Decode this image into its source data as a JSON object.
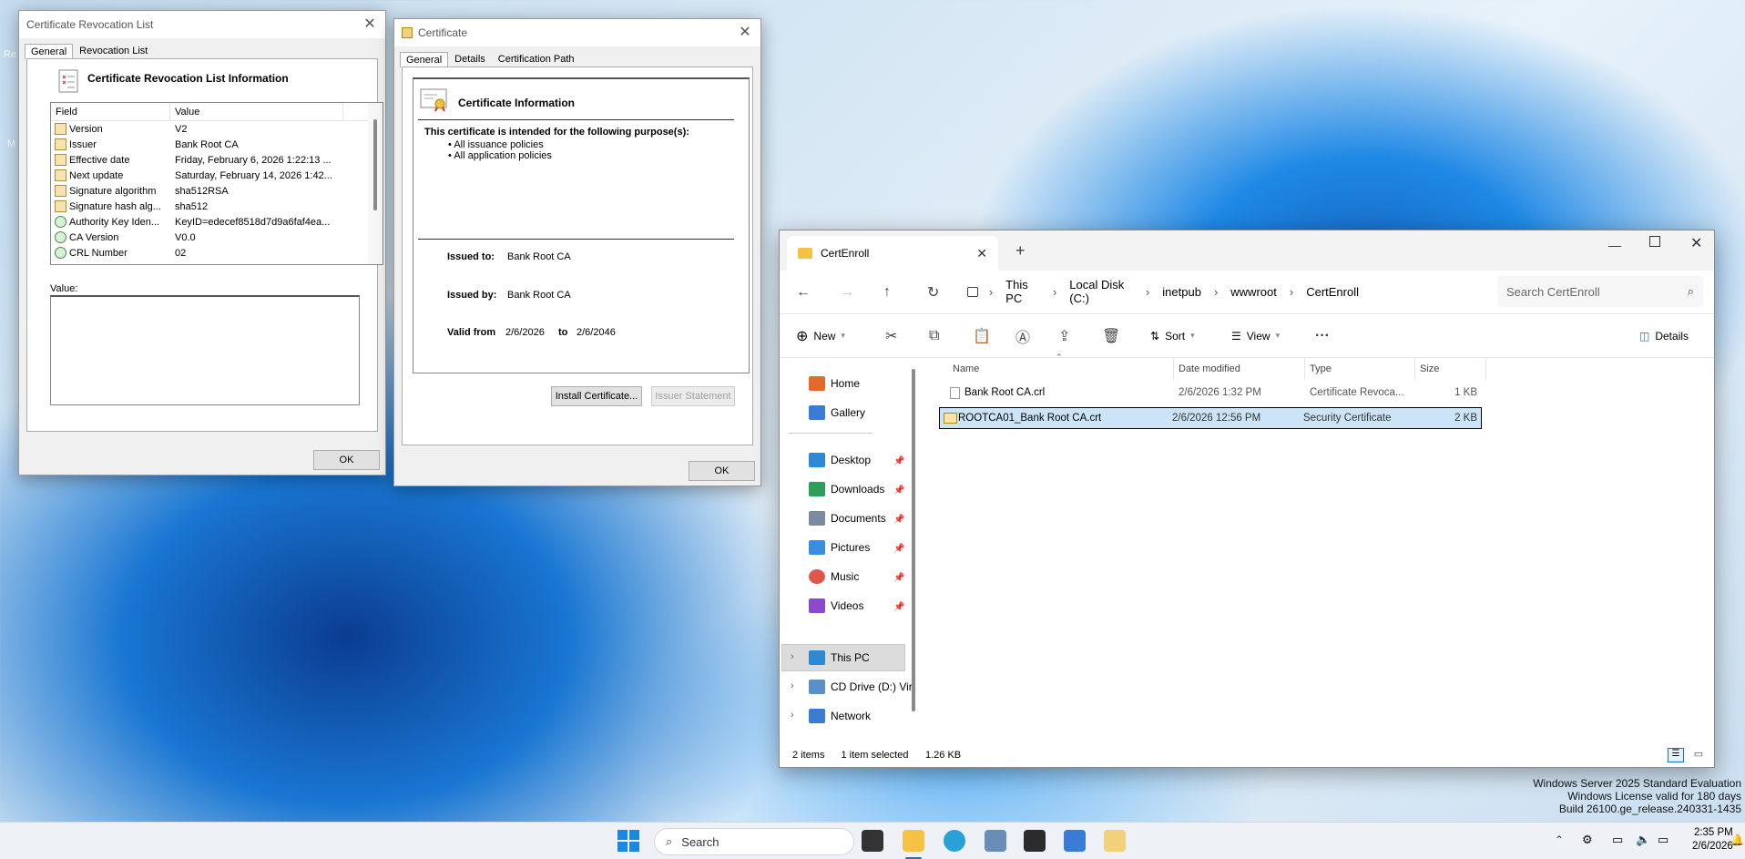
{
  "crl": {
    "title": "Certificate Revocation List",
    "tabs": [
      "General",
      "Revocation List"
    ],
    "heading": "Certificate Revocation List Information",
    "columns": [
      "Field",
      "Value"
    ],
    "rows": [
      [
        "Version",
        "V2"
      ],
      [
        "Issuer",
        "Bank Root CA"
      ],
      [
        "Effective date",
        "Friday, February 6, 2026 1:22:13 ..."
      ],
      [
        "Next update",
        "Saturday, February 14, 2026 1:42..."
      ],
      [
        "Signature algorithm",
        "sha512RSA"
      ],
      [
        "Signature hash alg...",
        "sha512"
      ],
      [
        "Authority Key Iden...",
        "KeyID=edecef8518d7d9a6faf4ea..."
      ],
      [
        "CA Version",
        "V0.0"
      ],
      [
        "CRL Number",
        "02"
      ]
    ],
    "value_label": "Value:",
    "ok": "OK"
  },
  "cert": {
    "title": "Certificate",
    "tabs": [
      "General",
      "Details",
      "Certification Path"
    ],
    "heading": "Certificate Information",
    "purpose": "This certificate is intended for the following purpose(s):",
    "purposes": [
      "All issuance policies",
      "All application policies"
    ],
    "issued_to_label": "Issued to:",
    "issued_to": "Bank Root CA",
    "issued_by_label": "Issued by:",
    "issued_by": "Bank Root CA",
    "valid_from_label": "Valid from",
    "valid_from": "2/6/2026",
    "to_label": "to",
    "valid_to": "2/6/2046",
    "install": "Install Certificate...",
    "issuer_stmt": "Issuer Statement",
    "ok": "OK"
  },
  "explorer": {
    "tab": "CertEnroll",
    "path": [
      "This PC",
      "Local Disk (C:)",
      "inetpub",
      "wwwroot",
      "CertEnroll"
    ],
    "search_placeholder": "Search CertEnroll",
    "cmd": {
      "new": "New",
      "sort": "Sort",
      "view": "View",
      "details": "Details"
    },
    "nav": {
      "home": "Home",
      "gallery": "Gallery",
      "desktop": "Desktop",
      "downloads": "Downloads",
      "documents": "Documents",
      "pictures": "Pictures",
      "music": "Music",
      "videos": "Videos",
      "thispc": "This PC",
      "cd": "CD Drive (D:) Vir",
      "network": "Network"
    },
    "columns": [
      "Name",
      "Date modified",
      "Type",
      "Size"
    ],
    "files": [
      {
        "name": "Bank Root CA.crl",
        "date": "2/6/2026 1:32 PM",
        "type": "Certificate Revoca...",
        "size": "1 KB"
      },
      {
        "name": "ROOTCA01_Bank Root CA.crt",
        "date": "2/6/2026 12:56 PM",
        "type": "Security Certificate",
        "size": "2 KB"
      }
    ],
    "status": {
      "items": "2 items",
      "selected": "1 item selected",
      "size": "1.26 KB"
    }
  },
  "watermark": [
    "Windows Server 2025 Standard Evaluation",
    "Windows License valid for 180 days",
    "Build 26100.ge_release.240331-1435"
  ],
  "taskbar": {
    "search": "Search",
    "time": "2:35 PM",
    "date": "2/6/2026"
  },
  "desktop_fragments": {
    "re": "Re",
    "m": "M"
  }
}
